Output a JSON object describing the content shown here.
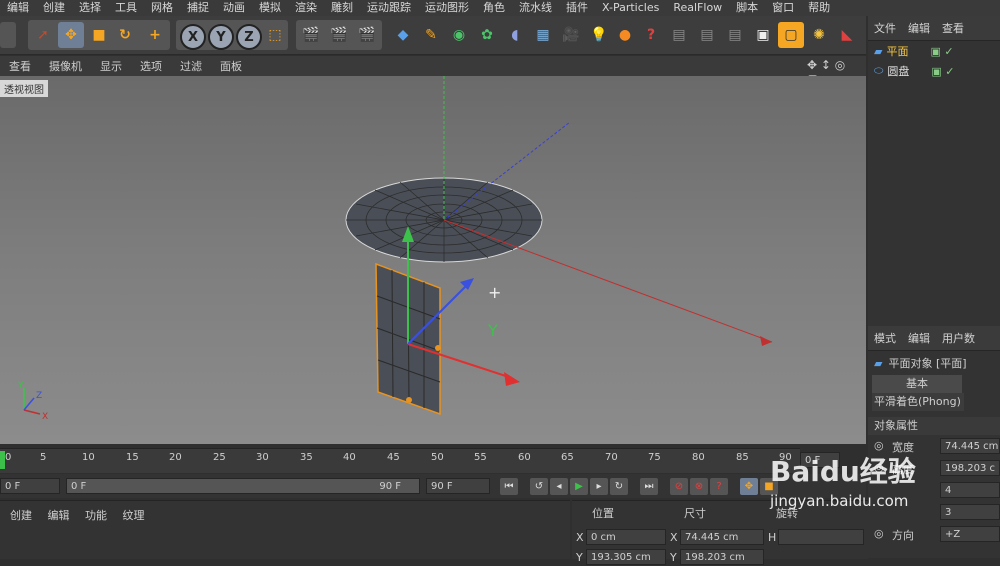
{
  "menubar": [
    "编辑",
    "创建",
    "选择",
    "工具",
    "网格",
    "捕捉",
    "动画",
    "模拟",
    "渲染",
    "雕刻",
    "运动跟踪",
    "运动图形",
    "角色",
    "流水线",
    "插件",
    "X-Particles",
    "RealFlow",
    "脚本",
    "窗口",
    "帮助"
  ],
  "toolbar": {
    "axis_buttons": [
      "X",
      "Y",
      "Z"
    ]
  },
  "viewport_menu": [
    "查看",
    "摄像机",
    "显示",
    "选项",
    "过滤",
    "面板"
  ],
  "viewport_label": "透视视图",
  "object_manager": {
    "tabs": [
      "文件",
      "编辑",
      "查看"
    ],
    "objects": [
      {
        "name": "平面",
        "color": "#f5c542"
      },
      {
        "name": "圆盘",
        "color": "#e0e0e0"
      }
    ]
  },
  "timeline": {
    "ticks": [
      "0",
      "5",
      "10",
      "15",
      "20",
      "25",
      "30",
      "35",
      "40",
      "45",
      "50",
      "55",
      "60",
      "65",
      "70",
      "75",
      "80",
      "85",
      "90"
    ],
    "current_frame": "0 F"
  },
  "playback": {
    "start_field": "0 F",
    "range_start": "0 F",
    "range_end": "90 F",
    "end_field": "90 F"
  },
  "material_menu": [
    "创建",
    "编辑",
    "功能",
    "纹理"
  ],
  "coords": {
    "position_label": "位置",
    "size_label": "尺寸",
    "rotation_label": "旋转",
    "x_pos": "0 cm",
    "x_size": "74.445 cm",
    "y_pos": "193.305 cm",
    "y_size": "198.203 cm"
  },
  "attributes": {
    "tabs": [
      "模式",
      "编辑",
      "用户数"
    ],
    "object_title": "平面对象 [平面]",
    "tab_basic": "基本",
    "tab_phong": "平滑着色(Phong)",
    "section": "对象属性",
    "width_label": "宽度",
    "width_value": "74.445 cm",
    "height_label": "高度",
    "height_value": "198.203 c",
    "seg_w_value": "4",
    "seg_h_value": "3",
    "orientation_label": "方向",
    "orientation_value": "+Z"
  },
  "watermark": {
    "brand": "Baidu经验",
    "url": "jingyan.baidu.com"
  }
}
